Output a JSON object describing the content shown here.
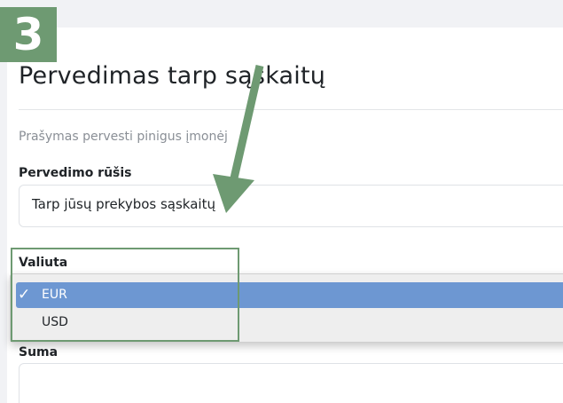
{
  "step": "3",
  "page": {
    "title": "Pervedimas tarp sąskaitų",
    "subtitle": "Prašymas pervesti pinigus įmonėj"
  },
  "transfer_type": {
    "label": "Pervedimo rūšis",
    "value": "Tarp jūsų prekybos sąskaitų"
  },
  "currency": {
    "label": "Valiuta",
    "options": [
      "EUR",
      "USD"
    ],
    "selected": "EUR",
    "checkmark": "✓"
  },
  "amount": {
    "label": "Suma",
    "value": ""
  },
  "colors": {
    "annotation_green": "#6e9a72",
    "selected_option": "#6d97d2"
  }
}
